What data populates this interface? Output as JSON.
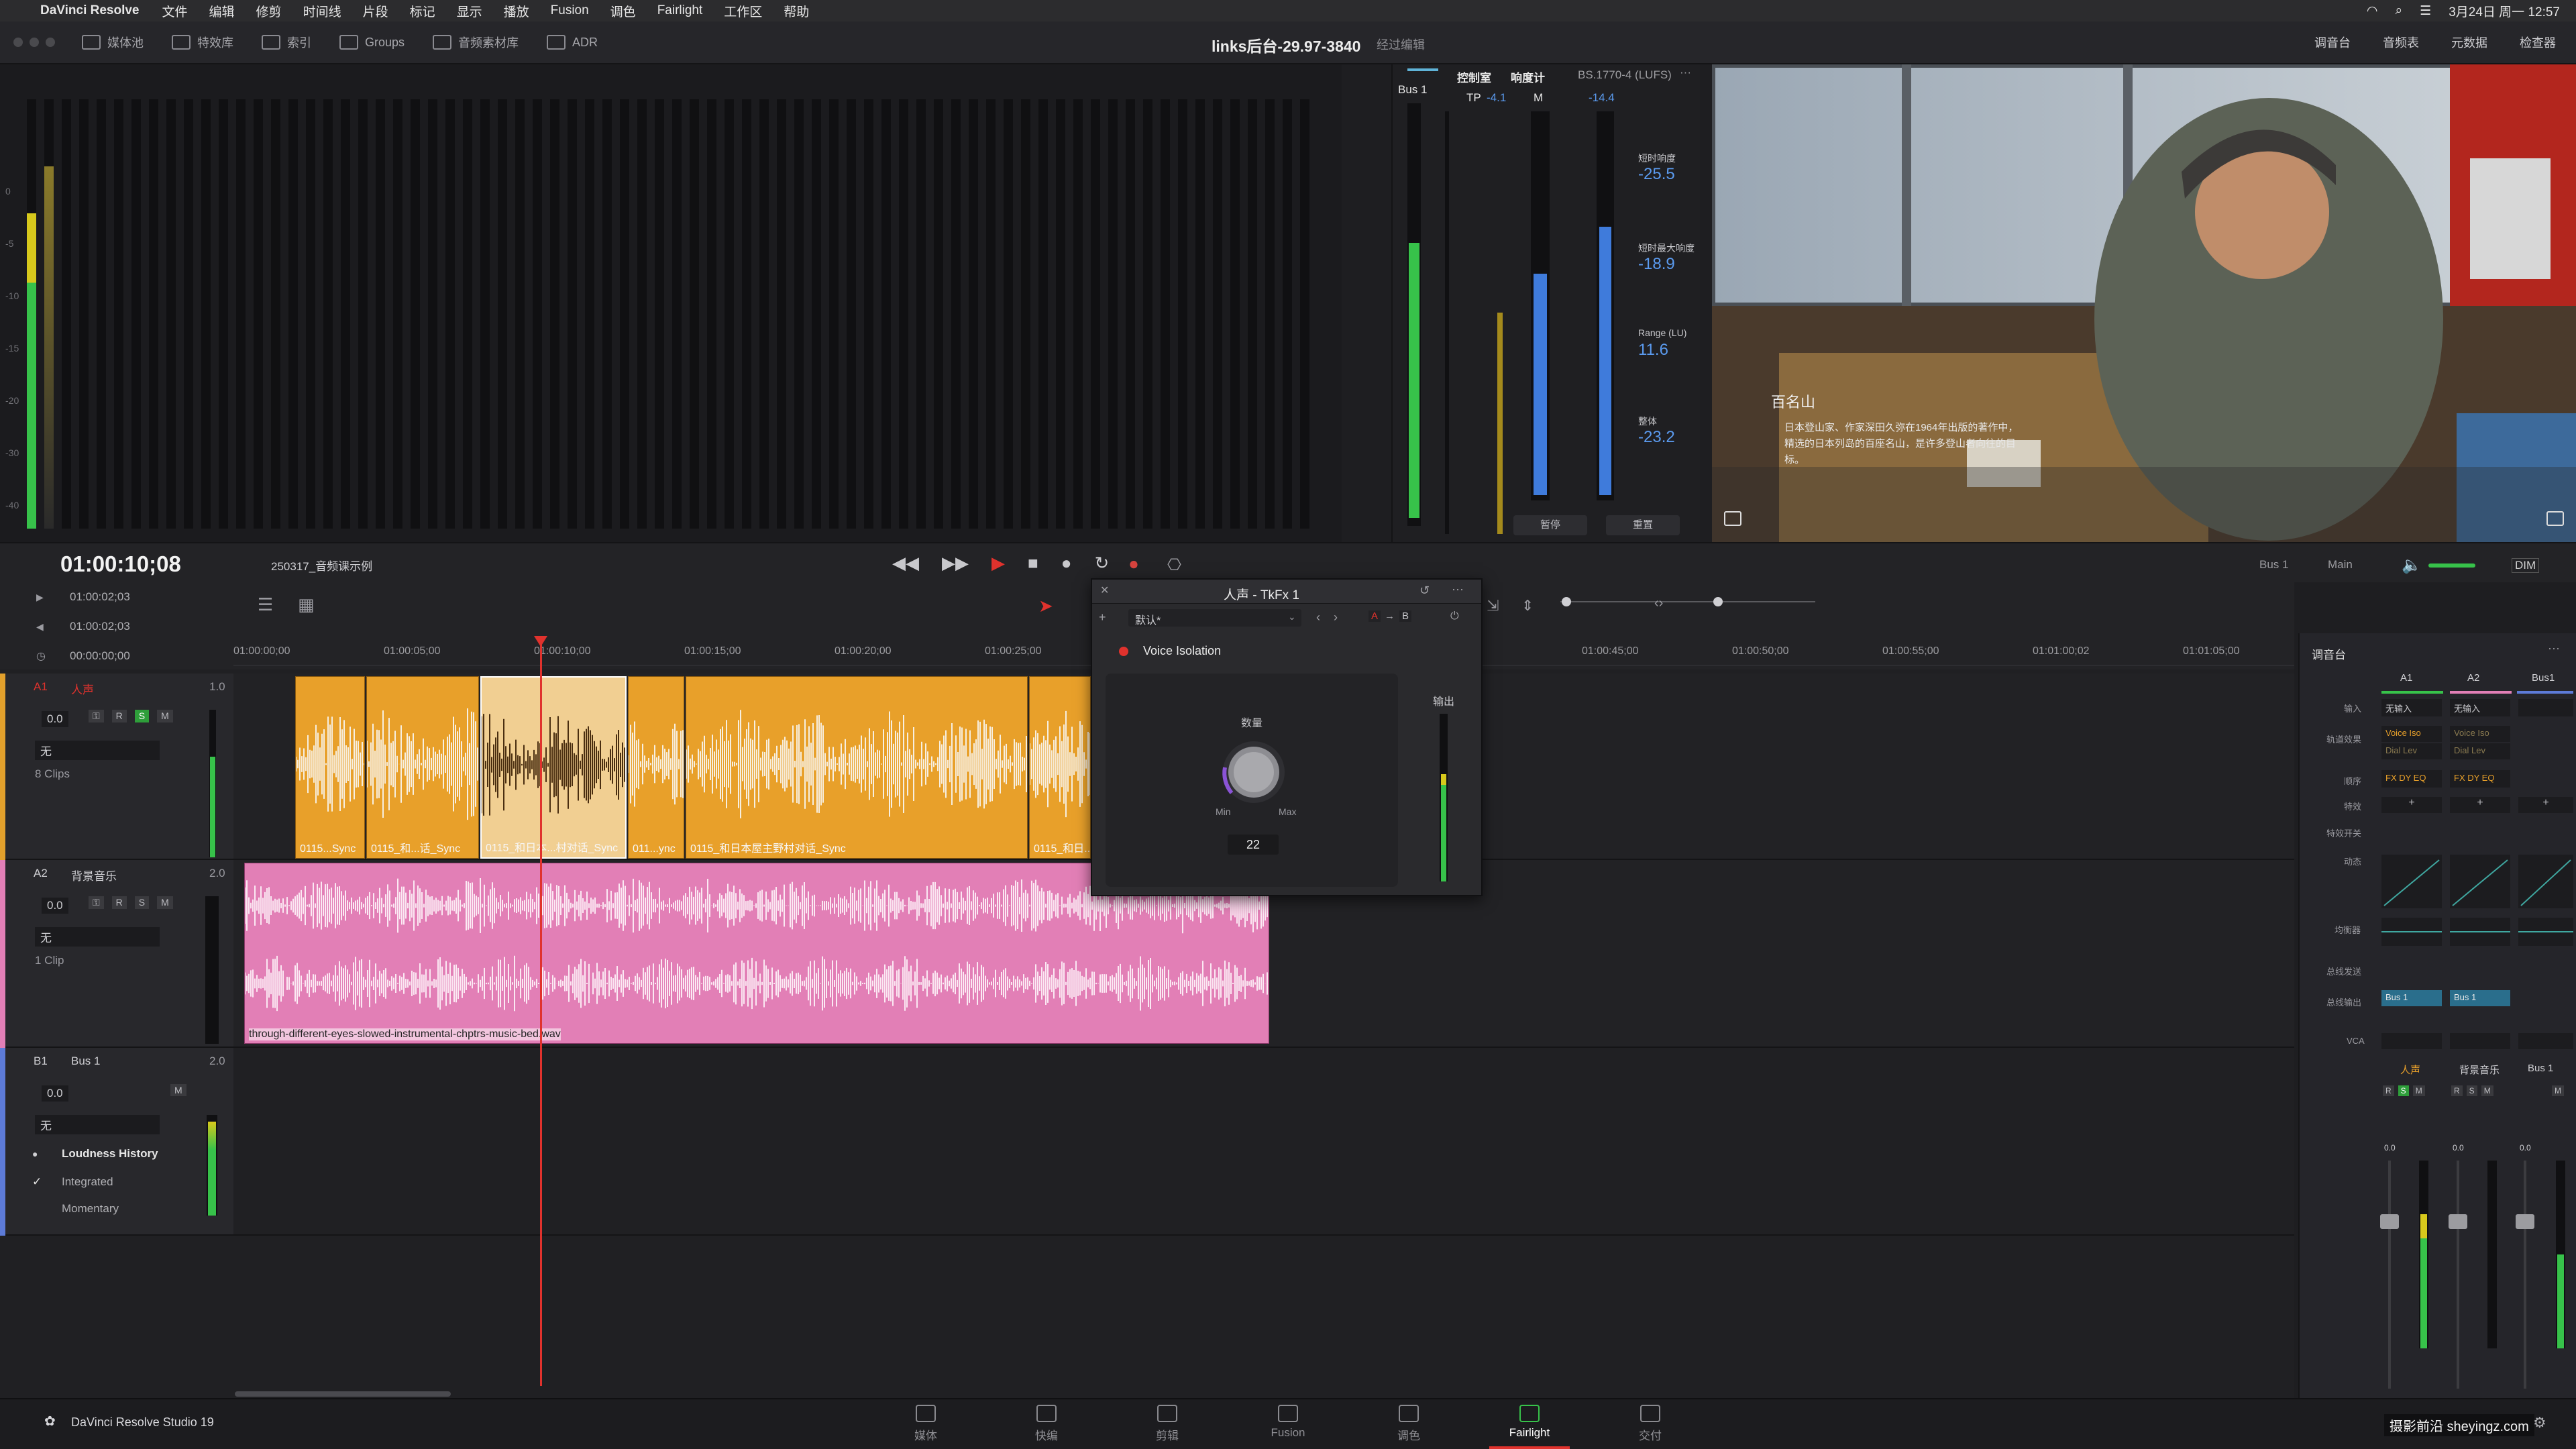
{
  "menubar": {
    "app_name": "DaVinci Resolve",
    "items": [
      "文件",
      "编辑",
      "修剪",
      "时间线",
      "片段",
      "标记",
      "显示",
      "播放",
      "Fusion",
      "调色",
      "Fairlight",
      "工作区",
      "帮助"
    ],
    "datetime": "3月24日 周一 12:57"
  },
  "toolbar": {
    "left": [
      "媒体池",
      "特效库",
      "索引",
      "Groups",
      "音频素材库",
      "ADR"
    ],
    "project_title": "links后台-29.97-3840",
    "project_status": "经过编辑",
    "right": [
      "调音台",
      "音频表",
      "元数据",
      "检查器"
    ]
  },
  "control_room": {
    "bus_label": "Bus 1",
    "title": "控制室",
    "tp_label": "TP",
    "tp_value": "-4.1",
    "loudness_title": "响度计",
    "loudness_standard": "BS.1770-4 (LUFS)",
    "m_label": "M",
    "m_value": "-14.4",
    "short_term_label": "短时响度",
    "short_term_value": "-25.5",
    "short_max_label": "短时最大响度",
    "short_max_value": "-18.9",
    "range_label": "Range (LU)",
    "range_value": "11.6",
    "integrated_label": "整体",
    "integrated_value": "-23.2",
    "pause_btn": "暂停",
    "reset_btn": "重置"
  },
  "viewer": {
    "subtitle_name": "百名山",
    "subtitle_text": "日本登山家、作家深田久弥在1964年出版的著作中，精选的日本列岛的百座名山，是许多登山者向往的目标。"
  },
  "transport": {
    "timecode": "01:00:10;08",
    "timeline_name": "250317_音频课示例",
    "bus_route_from": "Bus 1",
    "bus_route_to": "Main",
    "dim": "DIM"
  },
  "timeline_info": {
    "tc1": "01:00:02;03",
    "tc2": "01:00:02;03",
    "tc3": "00:00:00;00"
  },
  "ruler": [
    "01:00:00;00",
    "01:00:05;00",
    "01:00:10;00",
    "01:00:15;00",
    "01:00:20;00",
    "01:00:25;00",
    "01:00:45;00",
    "01:00:50;00",
    "01:00:55;00",
    "01:01:00;02",
    "01:01:05;00"
  ],
  "tracks": {
    "a1": {
      "id": "A1",
      "name": "人声",
      "ch": "1.0",
      "vol": "0.0",
      "input": "无",
      "clips": "8 Clips"
    },
    "a2": {
      "id": "A2",
      "name": "背景音乐",
      "ch": "2.0",
      "vol": "0.0",
      "input": "无",
      "clips": "1 Clip"
    },
    "b1": {
      "id": "B1",
      "name": "Bus 1",
      "ch": "2.0",
      "vol": "0.0",
      "input": "无"
    },
    "loudness_history": "Loudness History",
    "integrated": "Integrated",
    "momentary": "Momentary"
  },
  "clips": [
    "0115...Sync",
    "0115_和...话_Sync",
    "0115_和日本...村对话_Sync",
    "011...ync",
    "0115_和日本屋主野村对话_Sync",
    "0115_和日...",
    "through-different-eyes-slowed-instrumental-chptrs-music-bed.wav"
  ],
  "plugin": {
    "title": "人声 - TkFx 1",
    "preset": "默认*",
    "a_label": "A",
    "b_label": "B",
    "effect_name": "Voice Isolation",
    "amount_label": "数量",
    "min_label": "Min",
    "max_label": "Max",
    "amount_value": "22",
    "output_label": "输出"
  },
  "mixer": {
    "title": "调音台",
    "cols": [
      "A1",
      "A2",
      "Bus1"
    ],
    "row_labels": [
      "输入",
      "轨道效果",
      "顺序",
      "特效",
      "特效开关",
      "动态",
      "均衡器",
      "总线发送",
      "总线输出",
      "VCA"
    ],
    "input_values": [
      "无输入",
      "无输入"
    ],
    "fx_values": [
      "Voice Iso",
      "Voice Iso"
    ],
    "fx_values2": [
      "Dial Lev",
      "Dial Lev"
    ],
    "order_values": [
      "FX DY EQ",
      "FX DY EQ"
    ],
    "bus_out": [
      "Bus 1",
      "Bus 1"
    ],
    "strip_names": [
      "人声",
      "背景音乐",
      "Bus 1"
    ],
    "strip_vol": [
      "0.0",
      "0.0",
      "0.0"
    ]
  },
  "pages": [
    "媒体",
    "快编",
    "剪辑",
    "Fusion",
    "调色",
    "Fairlight",
    "交付"
  ],
  "footer": {
    "app": "DaVinci Resolve Studio 19",
    "watermark": "摄影前沿 sheyingz.com"
  },
  "colors": {
    "accent_red": "#e0322d",
    "orange_clip": "#e8a02a",
    "pink_clip": "#e27fb6",
    "meter_green": "#37c24a",
    "meter_yellow": "#d7c91c",
    "loud_blue": "#3f7bdb"
  }
}
